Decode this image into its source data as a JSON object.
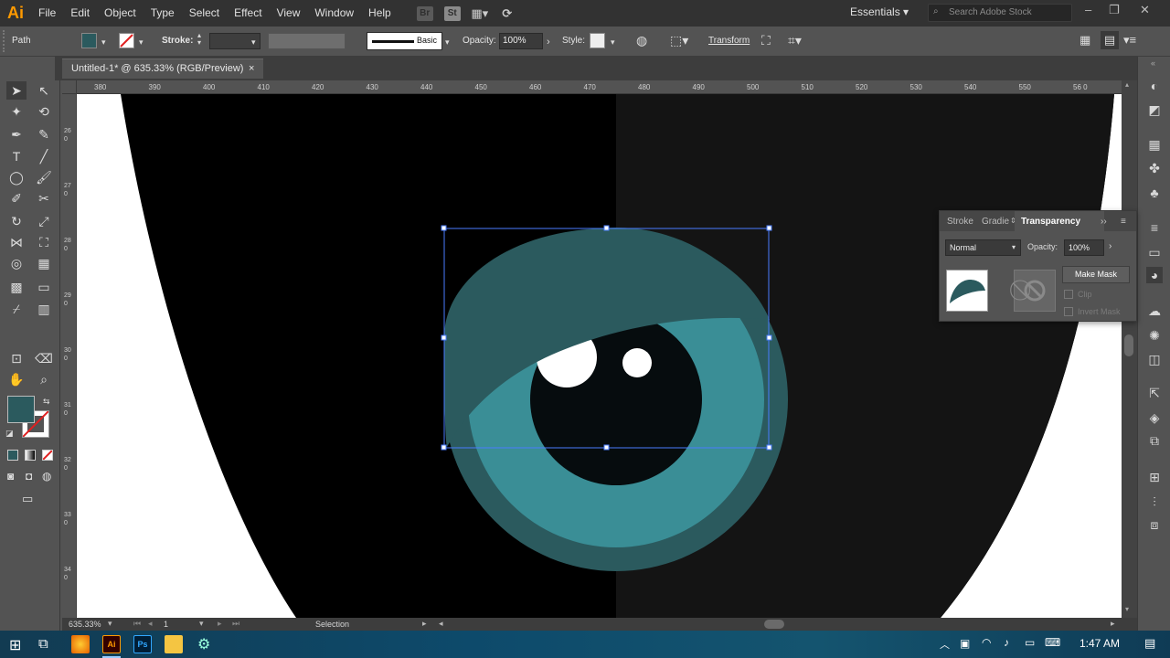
{
  "menubar": {
    "logo": "Ai",
    "items": [
      "File",
      "Edit",
      "Object",
      "Type",
      "Select",
      "Effect",
      "View",
      "Window",
      "Help"
    ],
    "bridge_icon": "Br",
    "stock_icon": "St",
    "workspace": "Essentials",
    "search_placeholder": "Search Adobe Stock"
  },
  "controlbar": {
    "selection_type": "Path",
    "fill_color": "#2b5a5e",
    "stroke_label": "Stroke:",
    "brush_label": "Basic",
    "opacity_label": "Opacity:",
    "opacity_value": "100%",
    "style_label": "Style:",
    "transform_label": "Transform"
  },
  "document": {
    "tab_title": "Untitled-1* @ 635.33% (RGB/Preview)",
    "close_glyph": "×"
  },
  "ruler_top": [
    "380",
    "390",
    "400",
    "410",
    "420",
    "430",
    "440",
    "450",
    "460",
    "470",
    "480",
    "490",
    "500",
    "510",
    "520",
    "530",
    "540",
    "550",
    "56 0"
  ],
  "ruler_left": [
    "260",
    "270",
    "280",
    "290",
    "300",
    "310",
    "320",
    "330",
    "340"
  ],
  "transparency_panel": {
    "tabs": [
      "Stroke",
      "Gradie",
      "Transparency"
    ],
    "blend_mode": "Normal",
    "opacity_label": "Opacity:",
    "opacity_value": "100%",
    "make_mask": "Make Mask",
    "clip": "Clip",
    "invert_mask": "Invert Mask"
  },
  "statusbar": {
    "zoom": "635.33%",
    "artboard": "1",
    "tool": "Selection"
  },
  "taskbar": {
    "time": "1:47 AM",
    "apps": [
      "firefox-app",
      "illustrator-app",
      "photoshop-app",
      "explorer-app",
      "network-app"
    ],
    "illustrator_label": "Ai",
    "photoshop_label": "Ps"
  },
  "colors": {
    "iris_outer": "#2b5a5e",
    "iris_inner": "#3a8e96",
    "pupil": "#060c0e",
    "eyelid": "#2b5a5e",
    "selection": "#4a7cff"
  }
}
